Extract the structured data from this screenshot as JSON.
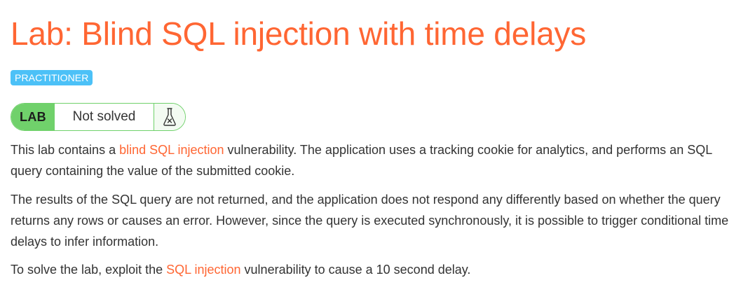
{
  "page_title": "Lab: Blind SQL injection with time delays",
  "level_badge": "PRACTITIONER",
  "lab_status": {
    "tag": "LAB",
    "state": "Not solved",
    "icon": "flask-icon"
  },
  "description": {
    "p1": {
      "before": "This lab contains a ",
      "link": "blind SQL injection",
      "after": " vulnerability. The application uses a tracking cookie for analytics, and performs an SQL query containing the value of the submitted cookie."
    },
    "p2": "The results of the SQL query are not returned, and the application does not respond any differently based on whether the query returns any rows or causes an error. However, since the query is executed synchronously, it is possible to trigger conditional time delays to infer information.",
    "p3": {
      "before": "To solve the lab, exploit the ",
      "link": "SQL injection",
      "after": " vulnerability to cause a 10 second delay."
    }
  },
  "colors": {
    "accent": "#ff6633",
    "badge": "#4cc1f7",
    "lab_green": "#70d16b"
  }
}
